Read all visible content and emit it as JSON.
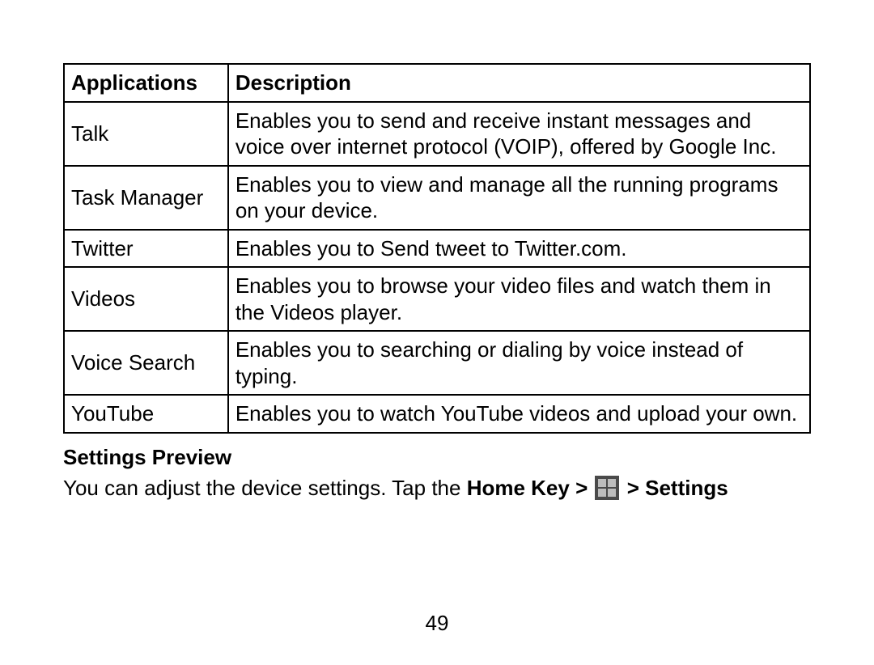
{
  "table": {
    "header": {
      "applications": "Applications",
      "description": "Description"
    },
    "rows": [
      {
        "app": "Talk",
        "desc": "Enables you to send and receive instant messages and voice over internet protocol (VOIP), offered by Google Inc."
      },
      {
        "app": "Task Manager",
        "desc": "Enables you to view and manage all the running programs on your device."
      },
      {
        "app": "Twitter",
        "desc": "Enables you to Send tweet to Twitter.com."
      },
      {
        "app": "Videos",
        "desc": "Enables you to browse your video files and watch them in the Videos player."
      },
      {
        "app": "Voice Search",
        "desc": "Enables you to searching or dialing by voice instead of typing."
      },
      {
        "app": "YouTube",
        "desc": "Enables you to watch YouTube videos and upload your own."
      }
    ]
  },
  "section_heading": "Settings Preview",
  "para_part1": "You can adjust the device settings. Tap the ",
  "para_home_key": "Home Key > ",
  "para_settings": " > Settings",
  "page_number": "49"
}
